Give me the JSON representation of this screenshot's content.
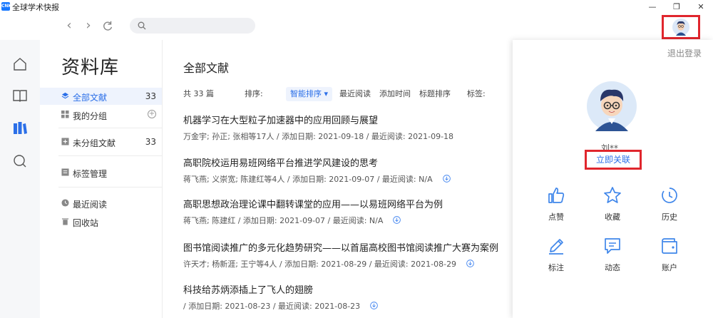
{
  "app": {
    "title": "全球学术快报",
    "logo_text": "CNKI"
  },
  "window": {
    "minimize": "—",
    "restore": "❐",
    "close": "✕"
  },
  "toolbar": {
    "search_placeholder": "",
    "back": "‹",
    "forward": "›"
  },
  "library": {
    "title": "资料库",
    "items": [
      {
        "label": "全部文献",
        "count": "33",
        "icon": "layers-icon"
      },
      {
        "label": "我的分组",
        "icon": "grid-icon"
      },
      {
        "label": "未分组文献",
        "count": "33",
        "icon": "plus-square-icon"
      },
      {
        "label": "标签管理",
        "icon": "tag-icon"
      },
      {
        "label": "最近阅读",
        "icon": "clock-icon"
      },
      {
        "label": "回收站",
        "icon": "trash-icon"
      }
    ]
  },
  "main": {
    "title": "全部文献",
    "total": "共 33 篇",
    "sort_label": "排序:",
    "sort_options": [
      "智能排序",
      "最近阅读",
      "添加时间",
      "标题排序"
    ],
    "tag_label": "标签:",
    "documents": [
      {
        "title": "机器学习在大型粒子加速器中的应用回顾与展望",
        "meta": "万金宇; 孙正; 张相等17人 / 添加日期: 2021-09-18 / 最近阅读: 2021-09-18",
        "download": false
      },
      {
        "title": "高职院校运用易班网络平台推进学风建设的思考",
        "meta": "蒋飞燕; 义崇宽; 陈建红等4人 / 添加日期: 2021-09-07 / 最近阅读: N/A",
        "download": true
      },
      {
        "title": "高职思想政治理论课中翻转课堂的应用——以易班网络平台为例",
        "meta": "蒋飞燕; 陈建红 / 添加日期: 2021-09-07 / 最近阅读: N/A",
        "download": true
      },
      {
        "title": "图书馆阅读推广的多元化趋势研究——以首届高校图书馆阅读推广大赛为案例",
        "meta": "许天才; 杨新涯; 王宁等4人 / 添加日期: 2021-08-29 / 最近阅读: 2021-08-29",
        "download": true
      },
      {
        "title": "科技给苏炳添插上了飞人的翅膀",
        "meta": "/ 添加日期: 2021-08-23 / 最近阅读: 2021-08-23",
        "download": true
      }
    ]
  },
  "panel": {
    "logout": "退出登录",
    "username": "刘**",
    "link_button": "立即关联",
    "actions": [
      {
        "label": "点赞",
        "icon": "thumbs-up-icon"
      },
      {
        "label": "收藏",
        "icon": "star-icon"
      },
      {
        "label": "历史",
        "icon": "history-icon"
      },
      {
        "label": "标注",
        "icon": "pen-icon"
      },
      {
        "label": "动态",
        "icon": "message-icon"
      },
      {
        "label": "账户",
        "icon": "wallet-icon"
      }
    ]
  },
  "colors": {
    "accent": "#2b6fe8",
    "highlight": "#e0262d",
    "rail": "#f6f7f9"
  }
}
